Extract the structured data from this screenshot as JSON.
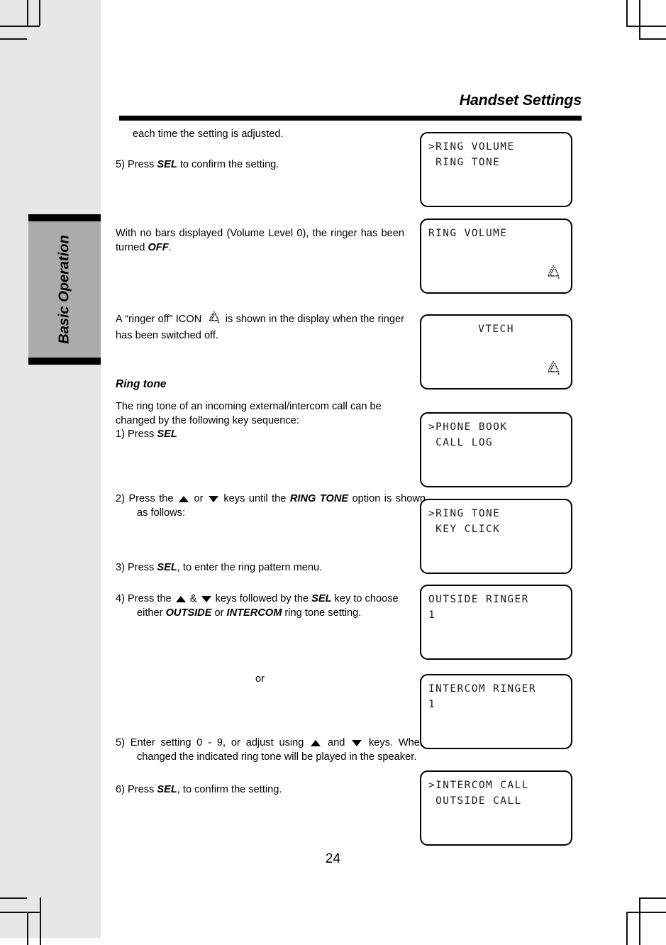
{
  "document": {
    "page_title": "Handset Settings",
    "page_number": "24",
    "side_tab_label": "Basic Operation"
  },
  "body_text": {
    "p_each_time": "each time the setting is adjusted.",
    "p_step5_volume": {
      "prefix": "5) Press ",
      "bold": "SEL",
      "suffix": " to confirm the setting."
    },
    "p_no_bars": {
      "prefix": "With no bars displayed (Volume Level 0), the ringer has been turned ",
      "bold": "OFF",
      "suffix": "."
    },
    "p_ringer_off_icon": {
      "prefix": "A “ringer off” ICON ",
      "icon": "ringer-off-icon",
      "suffix": " is shown in the display when the ringer has been switched off."
    },
    "section_ring_tone": "Ring tone",
    "p_ring_tone_intro": "The ring tone of an incoming external/intercom call can be changed by the following key sequence:",
    "p_step1": {
      "prefix": "1) Press ",
      "bold": "SEL"
    },
    "p_step2": {
      "a": "2) Press the ",
      "b": " or ",
      "c": " keys until the ",
      "bold": "RING TONE",
      "d": " option is shown as follows:"
    },
    "p_step3": {
      "prefix": "3) Press ",
      "bold": "SEL",
      "suffix": ", to enter the ring pattern menu."
    },
    "p_step4": {
      "a": "4)  Press the ",
      "b": " & ",
      "c": " keys followed by the ",
      "bold1": "SEL",
      "d": " key to choose either ",
      "bold2": "OUTSIDE",
      "e": " or ",
      "bold3": "INTERCOM",
      "f": " ring tone setting."
    },
    "or_label": "or",
    "p_step5_tone": {
      "a": "5) Enter setting 0 - 9, or adjust using ",
      "b": " and ",
      "c": " keys. When changed the indicated ring tone will be played in the speaker."
    },
    "p_step6": {
      "prefix": "6) Press ",
      "bold": "SEL",
      "suffix": ", to confirm the setting."
    }
  },
  "lcd_screens": [
    {
      "name": "lcd-ring-volume-menu",
      "line1": ">RING VOLUME",
      "line2": " RING TONE",
      "bell_icon": false,
      "align": "left"
    },
    {
      "name": "lcd-ring-volume-off",
      "line1": "RING VOLUME",
      "line2": "",
      "bell_icon": true,
      "align": "left"
    },
    {
      "name": "lcd-idle-vtech",
      "line1": "VTECH",
      "line2": "",
      "bell_icon": true,
      "align": "center"
    },
    {
      "name": "lcd-phone-book-menu",
      "line1": ">PHONE BOOK",
      "line2": " CALL LOG",
      "bell_icon": false,
      "align": "left"
    },
    {
      "name": "lcd-ring-tone-menu",
      "line1": ">RING TONE",
      "line2": " KEY CLICK",
      "bell_icon": false,
      "align": "left"
    },
    {
      "name": "lcd-outside-ringer",
      "line1": "OUTSIDE RINGER",
      "line2": "1",
      "bell_icon": false,
      "align": "left"
    },
    {
      "name": "lcd-intercom-ringer",
      "line1": "INTERCOM RINGER",
      "line2": "1",
      "bell_icon": false,
      "align": "left"
    },
    {
      "name": "lcd-call-type-menu",
      "line1": ">INTERCOM CALL",
      "line2": " OUTSIDE CALL",
      "bell_icon": false,
      "align": "left"
    }
  ],
  "colors": {
    "page_background": "#ffffff",
    "margin_band": "#e7e7e7",
    "side_tab_fill": "#ababab",
    "rule": "#000000",
    "text": "#000000"
  }
}
